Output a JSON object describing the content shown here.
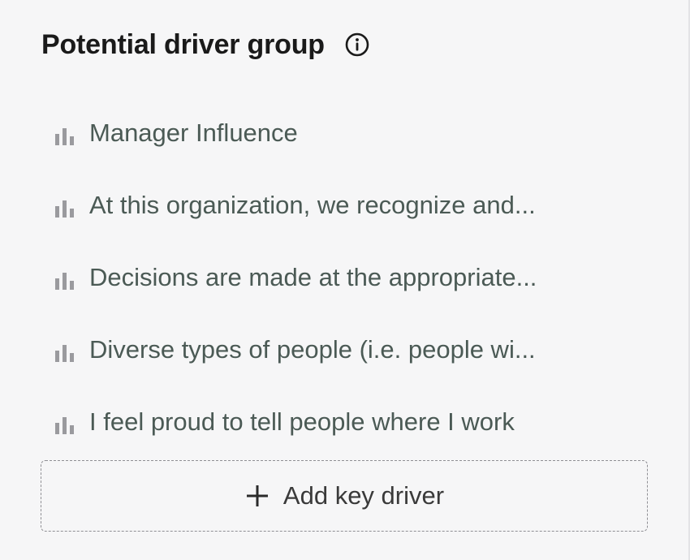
{
  "header": {
    "title": "Potential driver group",
    "info_icon": "info-circle-icon"
  },
  "drivers": [
    {
      "label": "Manager Influence",
      "icon": "bar-chart-icon"
    },
    {
      "label": "At this organization, we recognize and...",
      "icon": "bar-chart-icon"
    },
    {
      "label": "Decisions are made at the appropriate...",
      "icon": "bar-chart-icon"
    },
    {
      "label": "Diverse types of people (i.e. people wi...",
      "icon": "bar-chart-icon"
    },
    {
      "label": "I feel proud to tell people where I work",
      "icon": "bar-chart-icon"
    }
  ],
  "add_button": {
    "label": "Add key driver",
    "icon": "plus-icon"
  },
  "colors": {
    "background": "#f6f6f7",
    "driver_text": "#4b5a55",
    "bar_icon": "#9a9a9e",
    "title_text": "#1a1a1a"
  }
}
